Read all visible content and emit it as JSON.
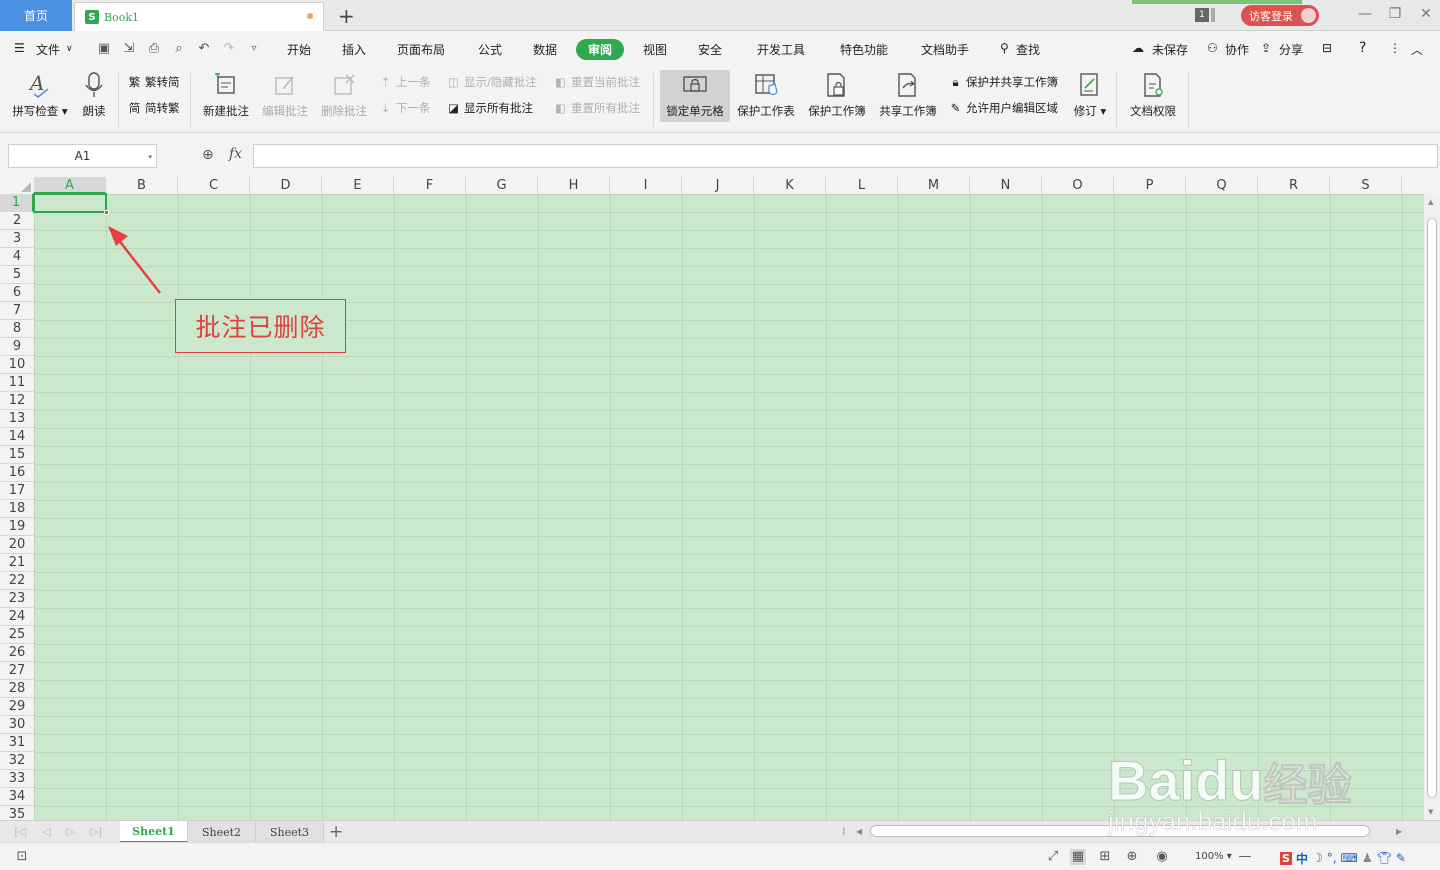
{
  "titlebar": {
    "home_tab": "首页",
    "doc_icon": "S",
    "doc_name": "Book1",
    "new_tab": "+",
    "badge": "1",
    "login": "访客登录"
  },
  "menu": {
    "file": "文件",
    "items": [
      "开始",
      "插入",
      "页面布局",
      "公式",
      "数据",
      "审阅",
      "视图",
      "安全",
      "开发工具",
      "特色功能",
      "文档助手"
    ],
    "search": "查找",
    "unsaved": "未保存",
    "collab": "协作",
    "share": "分享",
    "help": "?"
  },
  "ribbon": {
    "spellcheck": "拼写检查",
    "read": "朗读",
    "trad_to_simp": "繁转简",
    "simp_to_trad": "简转繁",
    "new_comment": "新建批注",
    "edit_comment": "编辑批注",
    "delete_comment": "删除批注",
    "prev": "上一条",
    "next": "下一条",
    "show_hide_comment": "显示/隐藏批注",
    "show_all_comments": "显示所有批注",
    "reset_current_comment": "重置当前批注",
    "reset_all_comments": "重置所有批注",
    "lock_cell": "锁定单元格",
    "protect_sheet": "保护工作表",
    "protect_workbook": "保护工作簿",
    "share_workbook": "共享工作簿",
    "protect_share_workbook": "保护并共享工作簿",
    "allow_edit_ranges": "允许用户编辑区域",
    "revise": "修订",
    "doc_rights": "文档权限"
  },
  "formula_bar": {
    "name_box": "A1",
    "fx": "fx",
    "formula": ""
  },
  "grid": {
    "columns": [
      "A",
      "B",
      "C",
      "D",
      "E",
      "F",
      "G",
      "H",
      "I",
      "J",
      "K",
      "L",
      "M",
      "N",
      "O",
      "P",
      "Q",
      "R",
      "S"
    ],
    "rows": [
      "1",
      "2",
      "3",
      "4",
      "5",
      "6",
      "7",
      "8",
      "9",
      "10",
      "11",
      "12",
      "13",
      "14",
      "15",
      "16",
      "17",
      "18",
      "19",
      "20",
      "21",
      "22",
      "23",
      "24",
      "25",
      "26",
      "27",
      "28",
      "29",
      "30",
      "31",
      "32",
      "33",
      "34",
      "35"
    ],
    "active_cell": "A1"
  },
  "annotation": {
    "text": "批注已删除"
  },
  "sheets": {
    "tabs": [
      "Sheet1",
      "Sheet2",
      "Sheet3"
    ],
    "active": "Sheet1",
    "add": "+"
  },
  "statusbar": {
    "zoom": "100%",
    "ime_lang": "中"
  },
  "watermark": {
    "brand": "Bai",
    "brand2": "du",
    "brand3": "经验",
    "url": "jingyan.baidu.com"
  },
  "colors": {
    "accent": "#2fa84f",
    "home_tab": "#4a90e2",
    "cell_bg": "#cbe8cd",
    "annotation": "#e04040",
    "login": "#d9534f"
  }
}
